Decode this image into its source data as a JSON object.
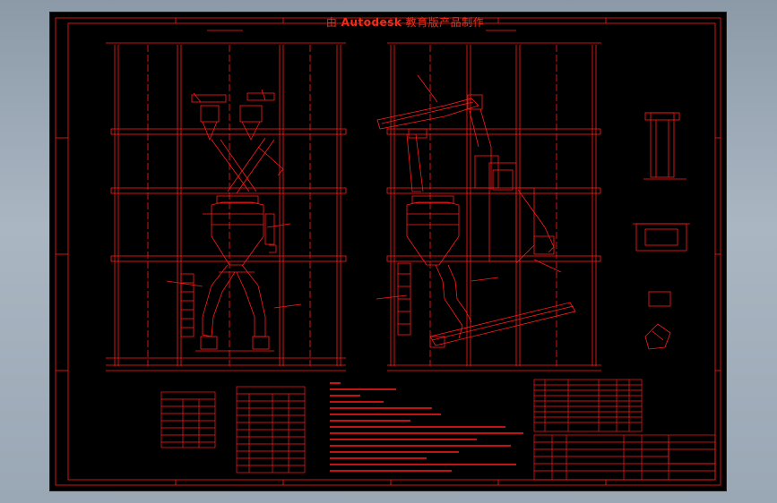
{
  "watermark": {
    "prefix": "由",
    "brand": "Autodesk",
    "suffix": "教育版产品制作"
  },
  "colors": {
    "background": "#000000",
    "line": "#ff1a1a",
    "outer": "#9aa7b4"
  }
}
